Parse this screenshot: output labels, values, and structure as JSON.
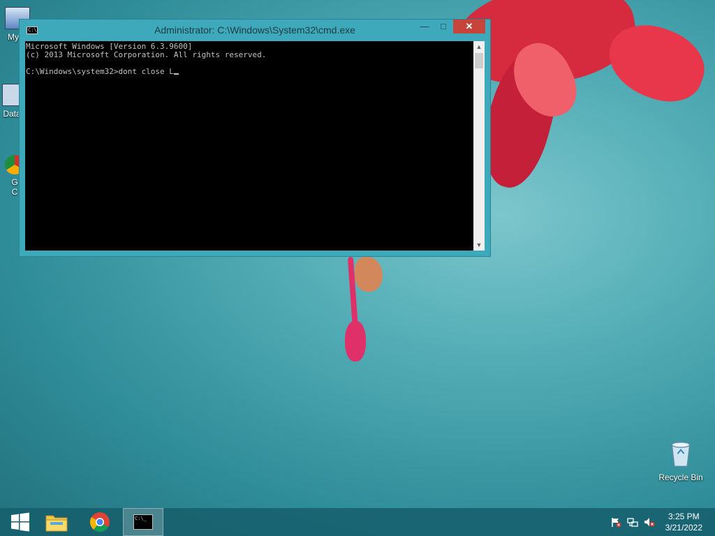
{
  "desktop": {
    "icons_left": [
      {
        "label": "My C"
      },
      {
        "label": "Data"
      },
      {
        "label": "G"
      },
      {
        "label": "C"
      }
    ],
    "recycle_bin": {
      "label": "Recycle Bin"
    }
  },
  "cmd": {
    "title": "Administrator: C:\\Windows\\System32\\cmd.exe",
    "minimize_glyph": "—",
    "maximize_glyph": "□",
    "close_glyph": "✕",
    "lines": [
      "Microsoft Windows [Version 6.3.9600]",
      "(c) 2013 Microsoft Corporation. All rights reserved.",
      "",
      "C:\\Windows\\system32>dont close L"
    ]
  },
  "taskbar": {
    "start_icon": "windows-logo-icon",
    "items": [
      "file-explorer-icon",
      "chrome-icon",
      "cmd-icon"
    ],
    "tray": [
      "action-center-flag-icon",
      "network-icon",
      "volume-muted-icon"
    ],
    "time": "3:25 PM",
    "date": "3/21/2022"
  }
}
